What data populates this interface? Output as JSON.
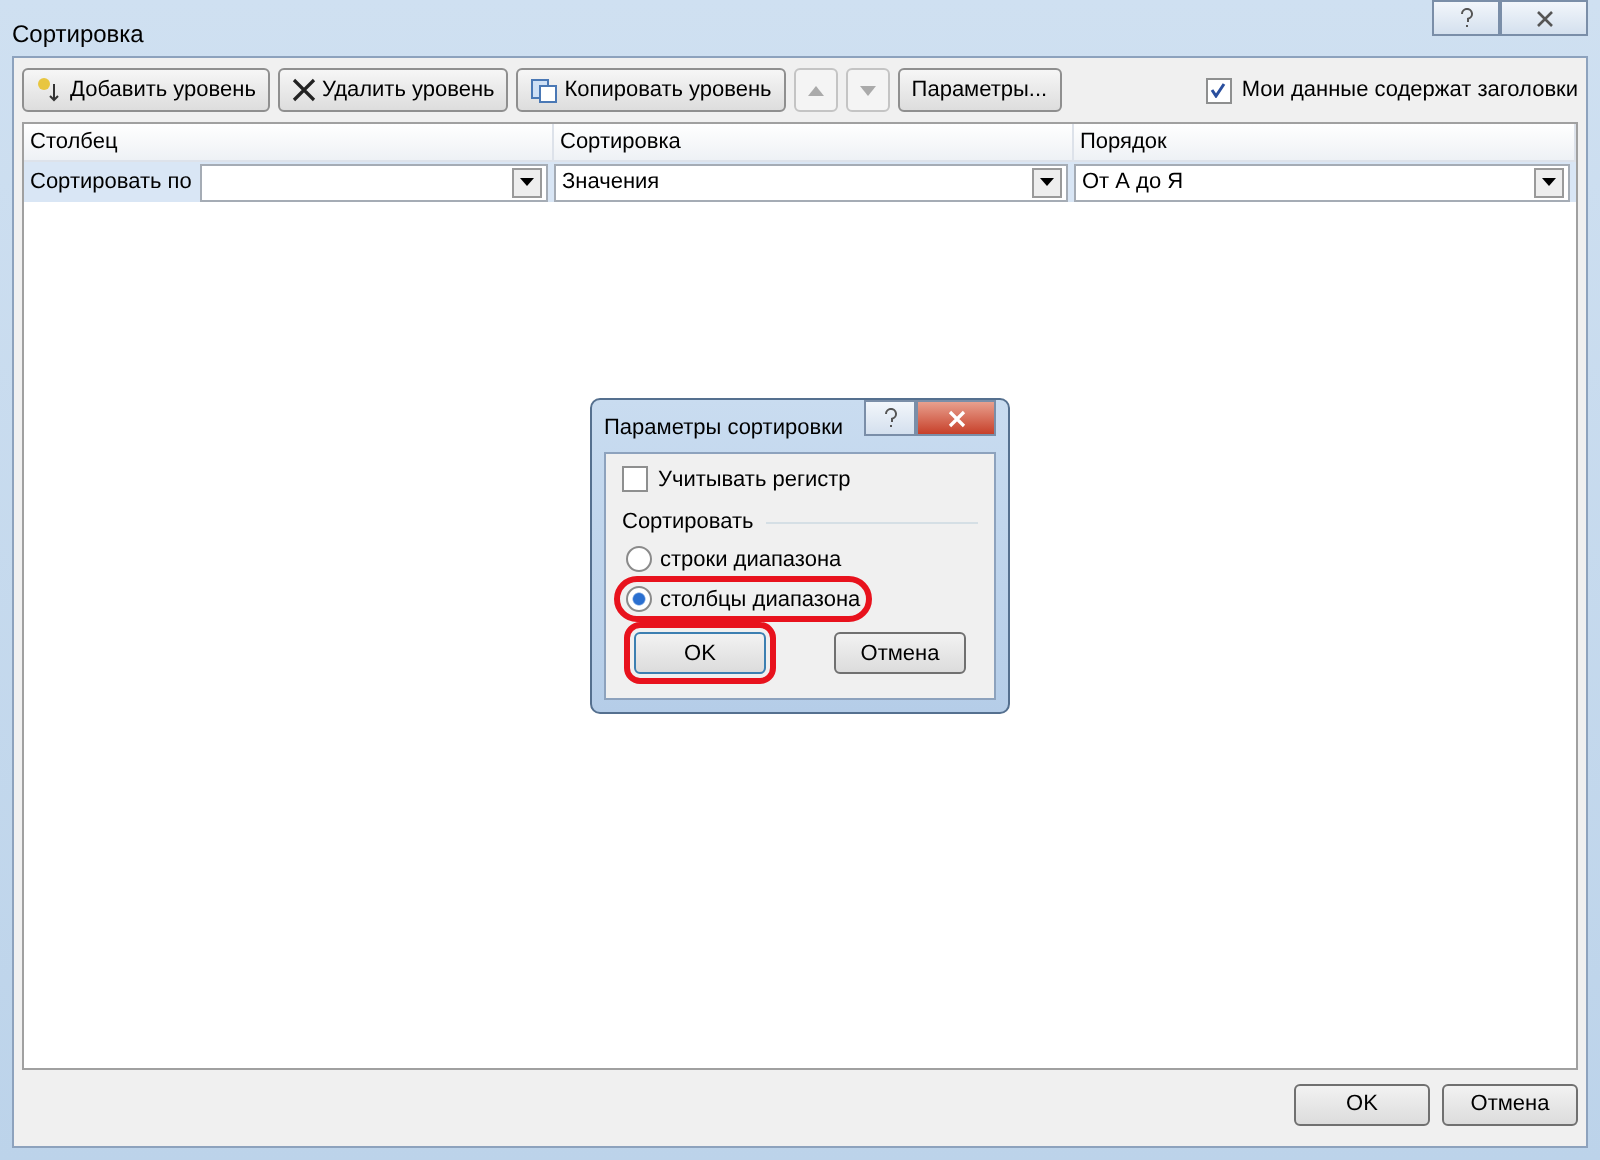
{
  "window": {
    "title": "Сортировка"
  },
  "toolbar": {
    "buttons": [
      {
        "kind": "add",
        "label": "Добавить уровень"
      },
      {
        "kind": "delete",
        "label": "Удалить уровень"
      },
      {
        "kind": "copy",
        "label": "Копировать уровень"
      },
      {
        "kind": "up"
      },
      {
        "kind": "down"
      },
      {
        "kind": "options",
        "label": "Параметры..."
      }
    ],
    "headers_checkbox": {
      "label": "Мои данные содержат заголовки",
      "checked": true
    }
  },
  "table": {
    "columns": [
      "Столбец",
      "Сортировка",
      "Порядок"
    ],
    "rows": [
      {
        "label": "Сортировать по",
        "column": "",
        "sort_on": "Значения",
        "order": "От А до Я"
      }
    ]
  },
  "options_dialog": {
    "title": "Параметры сортировки",
    "case_sensitive": {
      "label": "Учитывать регистр",
      "checked": false
    },
    "group_label": "Сортировать",
    "radios": [
      {
        "label": "строки диапазона",
        "selected": false,
        "highlighted": false
      },
      {
        "label": "столбцы диапазона",
        "selected": true,
        "highlighted": true
      }
    ],
    "ok": {
      "label": "OK",
      "highlighted": true
    },
    "cancel": "Отмена"
  },
  "buttons": [
    "OK",
    "Отмена"
  ]
}
